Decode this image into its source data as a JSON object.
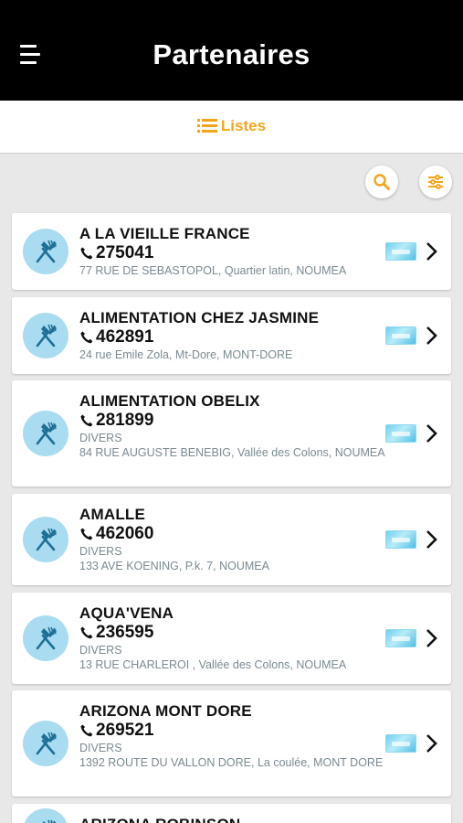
{
  "header": {
    "title": "Partenaires"
  },
  "tab": {
    "label": "Listes"
  },
  "colors": {
    "accent": "#f2a51a",
    "header_bg": "#000000",
    "icon_bg": "#a9dcf0"
  },
  "partners": [
    {
      "name": "A LA VIEILLE FRANCE",
      "phone": "275041",
      "category": "",
      "address": "77 RUE DE SEBASTOPOL, Quartier latin, NOUMEA"
    },
    {
      "name": "ALIMENTATION CHEZ JASMINE",
      "phone": "462891",
      "category": "",
      "address": "24 rue Emile Zola, Mt-Dore, MONT-DORE"
    },
    {
      "name": "ALIMENTATION OBELIX",
      "phone": "281899",
      "category": "DIVERS",
      "address": "84 RUE AUGUSTE BENEBIG, Vallée des Colons, NOUMEA"
    },
    {
      "name": "AMALLE",
      "phone": "462060",
      "category": "DIVERS",
      "address": "133 AVE KOENING, P.k. 7, NOUMEA"
    },
    {
      "name": "AQUA'VENA",
      "phone": "236595",
      "category": "DIVERS",
      "address": "13 RUE CHARLEROI , Vallée des Colons, NOUMEA"
    },
    {
      "name": "ARIZONA MONT DORE",
      "phone": "269521",
      "category": "DIVERS",
      "address": "1392 ROUTE DU VALLON DORE, La coulée, MONT DORE"
    },
    {
      "name": "ARIZONA ROBINSON",
      "phone": "",
      "category": "",
      "address": ""
    }
  ]
}
